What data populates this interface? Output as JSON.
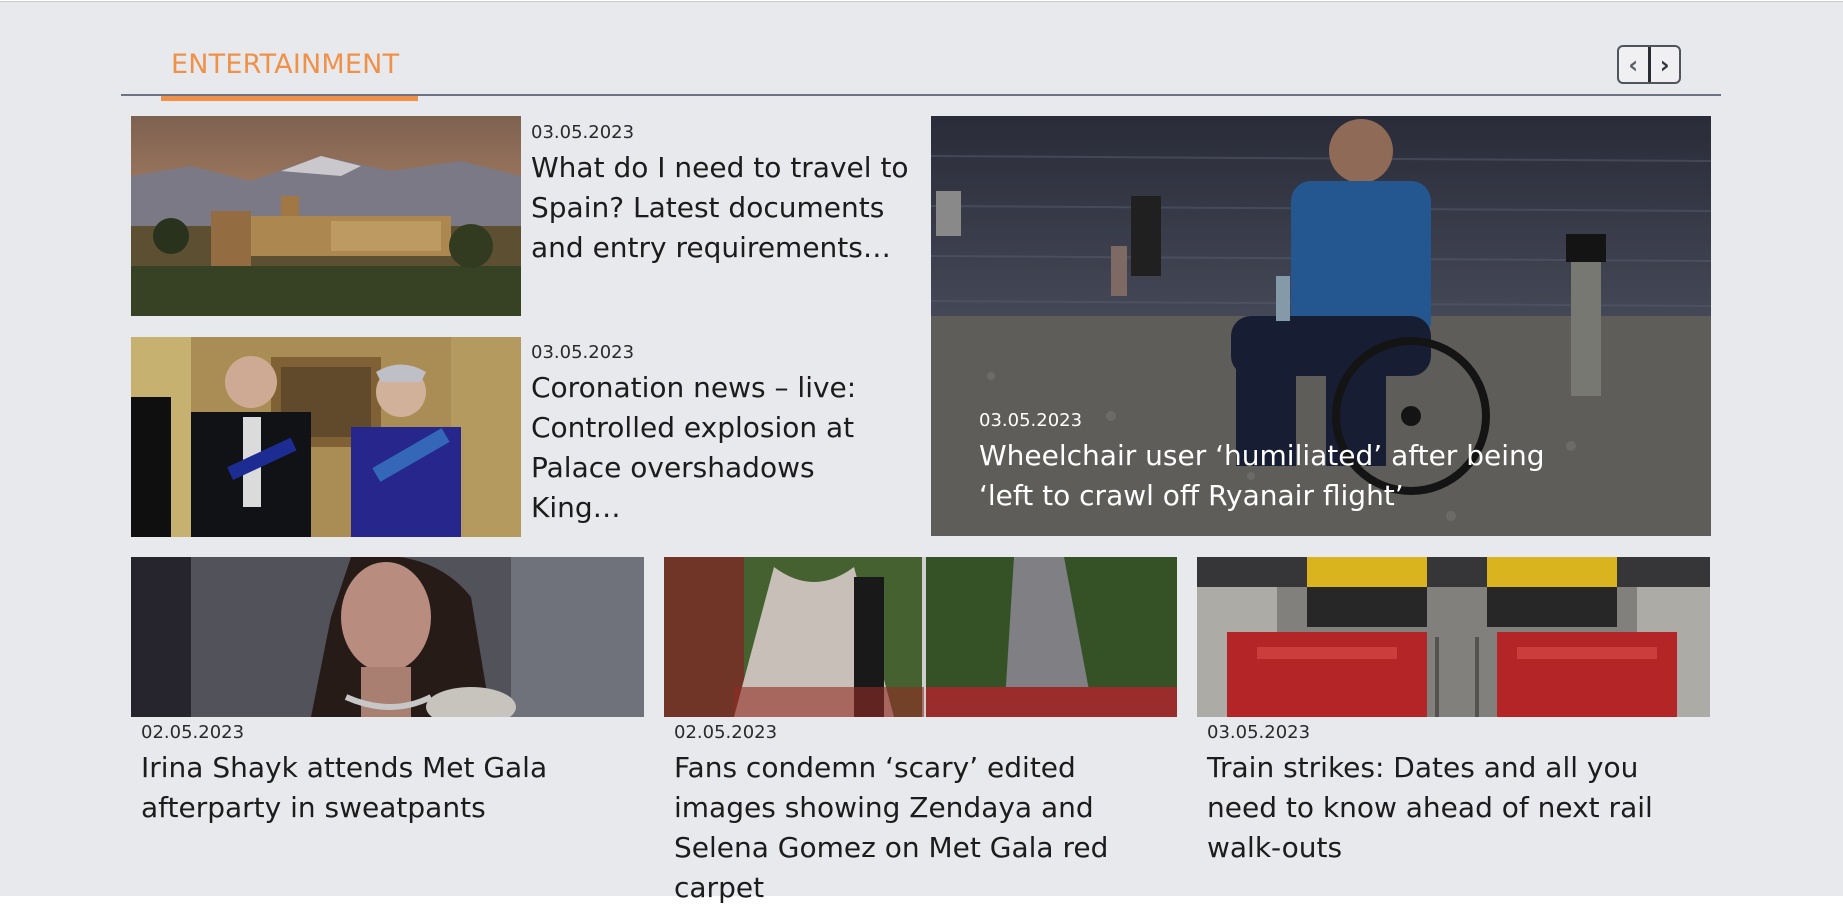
{
  "section": {
    "title": "ENTERTAINMENT",
    "accent_color": "#f0914a",
    "nav": {
      "prev_icon": "chevron-left-icon",
      "next_icon": "chevron-right-icon"
    }
  },
  "articles": {
    "spain": {
      "date": "03.05.2023",
      "title": "What do I need to travel to Spain? Latest documents and entry requirements…"
    },
    "coronation": {
      "date": "03.05.2023",
      "title": "Coronation news – live: Controlled explosion at Palace overshadows King…"
    },
    "wheelchair": {
      "date": "03.05.2023",
      "title": "Wheelchair user ‘humiliated’ after being ‘left to crawl off Ryanair flight’"
    },
    "irina": {
      "date": "02.05.2023",
      "title": "Irina Shayk attends Met Gala afterparty in sweatpants"
    },
    "zendaya": {
      "date": "02.05.2023",
      "title": "Fans condemn ‘scary’ edited images showing Zendaya and Selena Gomez on Met Gala red carpet"
    },
    "trains": {
      "date": "03.05.2023",
      "title": "Train strikes: Dates and all you need to know ahead of next rail walk-outs"
    }
  }
}
